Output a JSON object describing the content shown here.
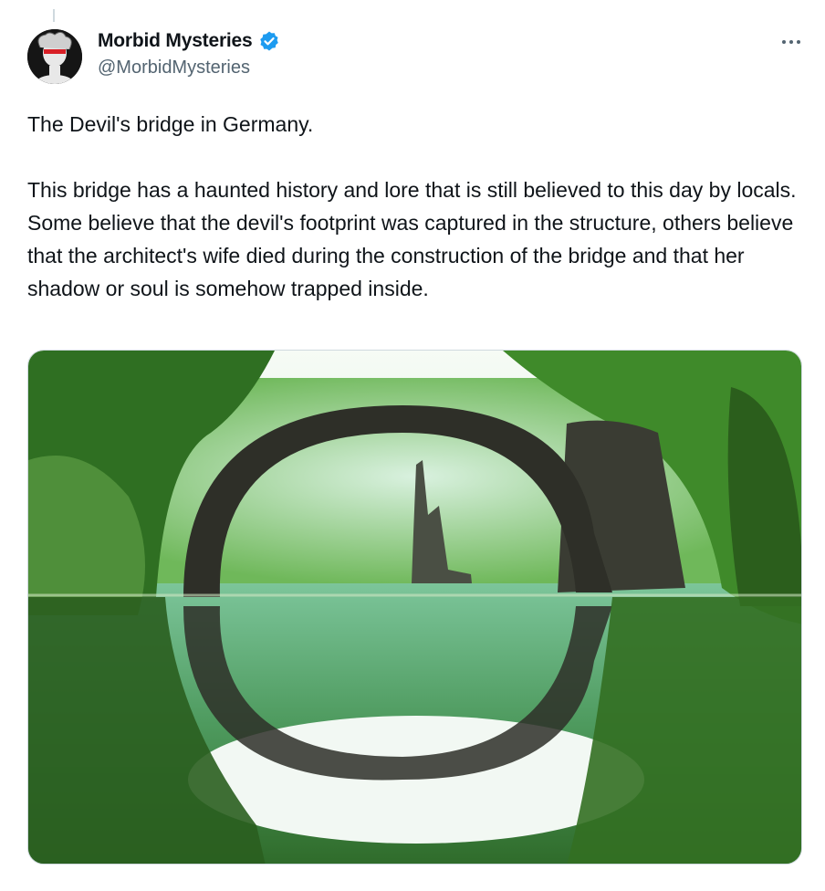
{
  "author": {
    "display_name": "Morbid Mysteries",
    "handle": "@MorbidMysteries",
    "verified": true,
    "verified_color": "#1d9bf0",
    "avatar_icon": "skull-avatar-icon"
  },
  "tweet": {
    "text": "The Devil's bridge in Germany.\n\nThis bridge has a haunted history and lore that is still believed to this day by locals. Some believe that the devil's footprint was captured in the structure, others believe that the architect's wife died during the construction of the bridge and that her shadow or soul is somehow trapped inside."
  },
  "media": {
    "subject": "stone arch bridge reflecting in lake forming a circle",
    "palette": {
      "forest": "#3f8a2a",
      "light": "#9ed36a",
      "water": "#5fae8e",
      "stone": "#2e2f28",
      "sky": "#f4fbf6"
    }
  },
  "menu": {
    "icon": "more-options-icon"
  }
}
